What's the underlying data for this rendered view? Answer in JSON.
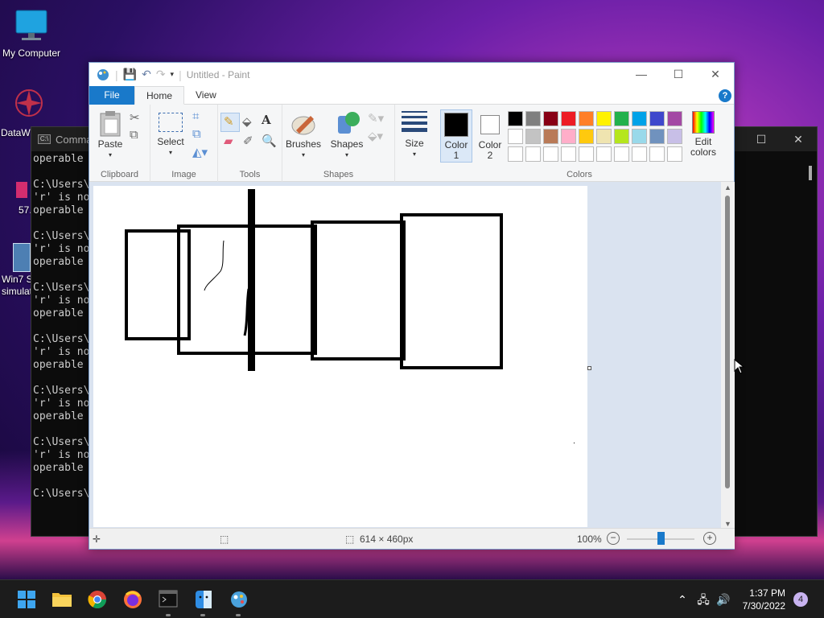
{
  "desktop": {
    "icons": [
      {
        "label": "My Computer"
      },
      {
        "label": "DataW..."
      },
      {
        "label": "57..."
      },
      {
        "label": "Win7 S\nsimulat..."
      }
    ]
  },
  "console": {
    "title": "Comma...",
    "lines": [
      "operable",
      "",
      "C:\\Users\\",
      "'r' is no",
      "operable",
      "",
      "C:\\Users\\",
      "'r' is no",
      "operable",
      "",
      "C:\\Users\\",
      "'r' is no",
      "operable",
      "",
      "C:\\Users\\",
      "'r' is no",
      "operable",
      "",
      "C:\\Users\\",
      "'r' is no",
      "operable",
      "",
      "C:\\Users\\",
      "'r' is no",
      "operable",
      "",
      "C:\\Users\\"
    ]
  },
  "paint": {
    "title": "Untitled - Paint",
    "tabs": {
      "file": "File",
      "home": "Home",
      "view": "View"
    },
    "ribbon": {
      "clipboard": {
        "paste": "Paste",
        "group": "Clipboard"
      },
      "image": {
        "select": "Select",
        "group": "Image"
      },
      "tools": {
        "group": "Tools"
      },
      "shapes": {
        "brushes": "Brushes",
        "shapes": "Shapes",
        "group": "Shapes"
      },
      "size": "Size",
      "color1": "Color\n1",
      "color2": "Color\n2",
      "edit_colors": "Edit\ncolors",
      "colors_group": "Colors"
    },
    "palette": [
      "#000000",
      "#7f7f7f",
      "#880015",
      "#ed1c24",
      "#ff7f27",
      "#fff200",
      "#22b14c",
      "#00a2e8",
      "#3f48cc",
      "#a349a4",
      "#ffffff",
      "#c3c3c3",
      "#b97a57",
      "#ffaec9",
      "#ffc90e",
      "#efe4b0",
      "#b5e61d",
      "#99d9ea",
      "#7092be",
      "#c8bfe7",
      "#ffffff",
      "#ffffff",
      "#ffffff",
      "#ffffff",
      "#ffffff",
      "#ffffff",
      "#ffffff",
      "#ffffff",
      "#ffffff",
      "#ffffff"
    ],
    "color1": "#000000",
    "color2": "#ffffff",
    "status": {
      "dimensions": "614 × 460px",
      "zoom": "100%"
    }
  },
  "taskbar": {
    "time": "1:37 PM",
    "date": "7/30/2022",
    "notifications": "4"
  }
}
